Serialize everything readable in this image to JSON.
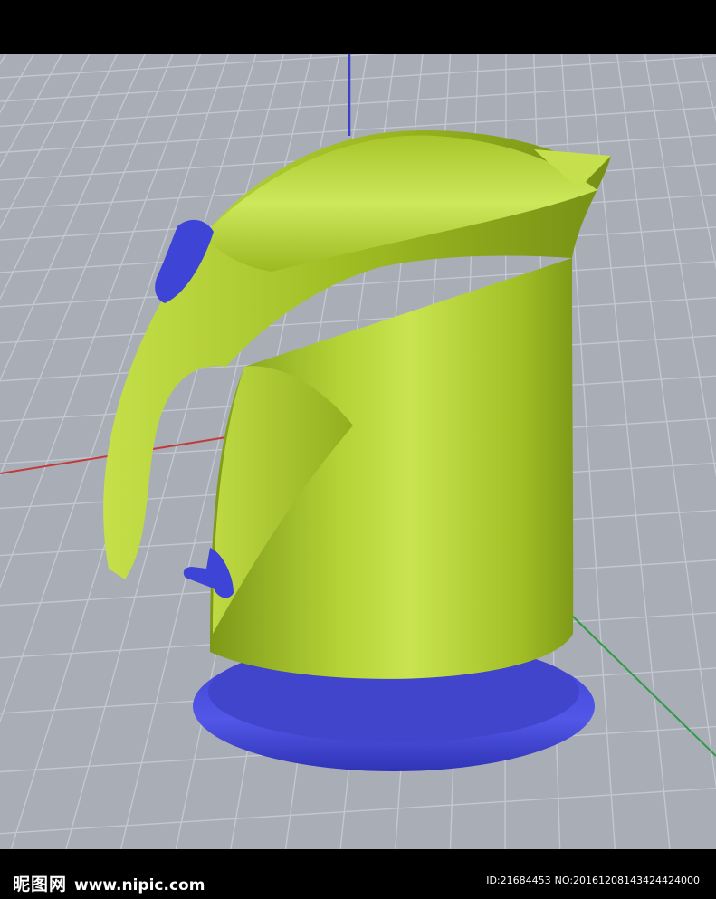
{
  "colors": {
    "background": "#000000",
    "viewport": "#a9adb6",
    "grid": "#bec2cb",
    "kettle_body": "#a8c52e",
    "kettle_highlight": "#d3ec64",
    "kettle_shadow": "#6f8a14",
    "base_ring": "#4a4fe0",
    "axis_x": "#c23a3a",
    "axis_y": "#2f9a47",
    "axis_z": "#3a40c8"
  },
  "watermark": {
    "site_cn": "昵图网",
    "site_url": "www.nipic.com"
  },
  "image_info": {
    "id": "ID:21684453",
    "no": "NO:20161208143424424000"
  }
}
